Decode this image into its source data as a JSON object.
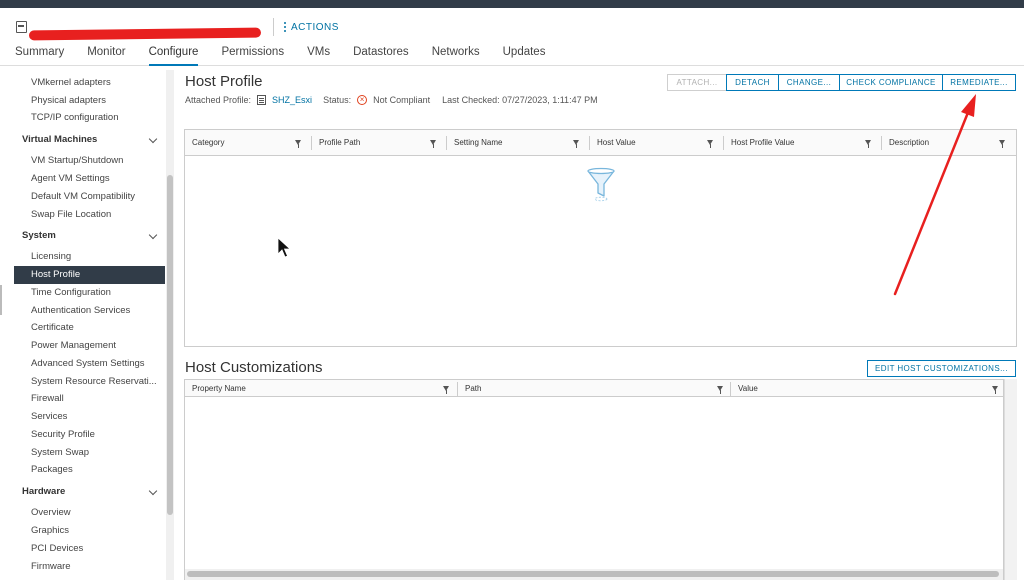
{
  "header": {
    "object_name": "",
    "actions_label": "ACTIONS"
  },
  "tabs": [
    "Summary",
    "Monitor",
    "Configure",
    "Permissions",
    "VMs",
    "Datastores",
    "Networks",
    "Updates"
  ],
  "sidebar": {
    "items": [
      {
        "label": "VMkernel adapters"
      },
      {
        "label": "Physical adapters"
      },
      {
        "label": "TCP/IP configuration"
      },
      {
        "label": "Virtual Machines",
        "group": true
      },
      {
        "label": "VM Startup/Shutdown"
      },
      {
        "label": "Agent VM Settings"
      },
      {
        "label": "Default VM Compatibility"
      },
      {
        "label": "Swap File Location"
      },
      {
        "label": "System",
        "group": true
      },
      {
        "label": "Licensing"
      },
      {
        "label": "Host Profile",
        "selected": true
      },
      {
        "label": "Time Configuration"
      },
      {
        "label": "Authentication Services"
      },
      {
        "label": "Certificate"
      },
      {
        "label": "Power Management"
      },
      {
        "label": "Advanced System Settings"
      },
      {
        "label": "System Resource Reservati..."
      },
      {
        "label": "Firewall"
      },
      {
        "label": "Services"
      },
      {
        "label": "Security Profile"
      },
      {
        "label": "System Swap"
      },
      {
        "label": "Packages"
      },
      {
        "label": "Hardware",
        "group": true
      },
      {
        "label": "Overview"
      },
      {
        "label": "Graphics"
      },
      {
        "label": "PCI Devices"
      },
      {
        "label": "Firmware"
      }
    ]
  },
  "host_profile": {
    "title": "Host Profile",
    "attached_label": "Attached Profile:",
    "attached_value": "SHZ_Esxi",
    "status_label": "Status:",
    "status_value": "Not Compliant",
    "last_checked_label": "Last Checked:",
    "last_checked_value": "07/27/2023, 1:11:47 PM",
    "buttons": {
      "attach": "ATTACH...",
      "detach": "DETACH",
      "change": "CHANGE...",
      "check": "CHECK COMPLIANCE",
      "remediate": "REMEDIATE..."
    },
    "columns": [
      "Category",
      "Profile Path",
      "Setting Name",
      "Host Value",
      "Host Profile Value",
      "Description"
    ]
  },
  "host_customizations": {
    "title": "Host Customizations",
    "edit_button": "EDIT HOST CUSTOMIZATIONS...",
    "columns": [
      "Property Name",
      "Path",
      "Value"
    ]
  },
  "colors": {
    "accent": "#0079b8",
    "link": "#0072a3",
    "selected_bg": "#313c48",
    "not_compliant": "#e0421e",
    "annotation_arrow": "#e8201f"
  }
}
